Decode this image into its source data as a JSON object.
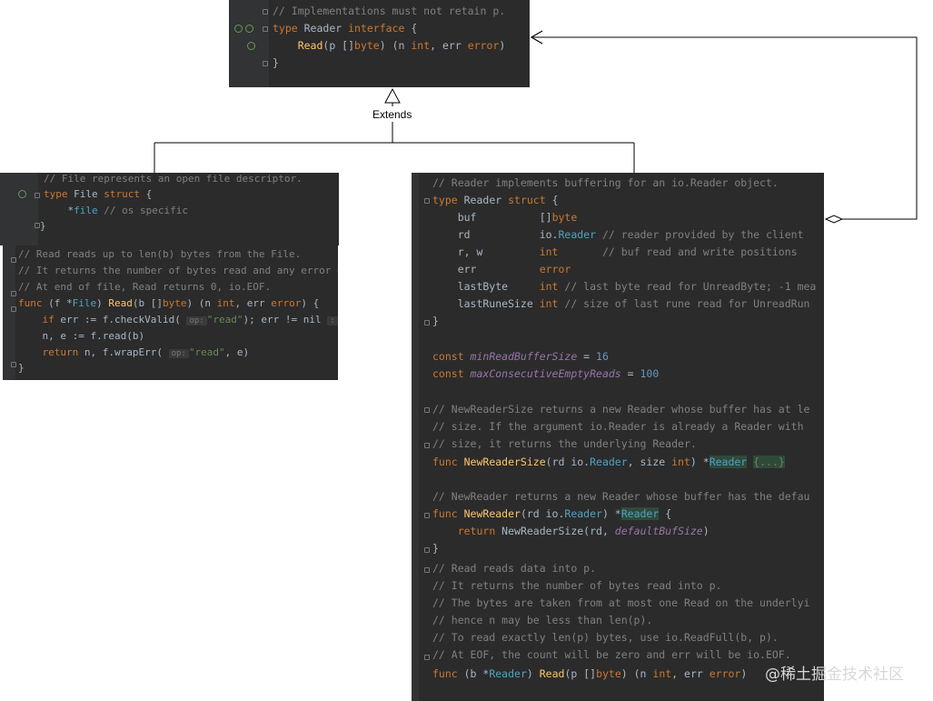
{
  "extends_label": "Extends",
  "watermark": "@稀土掘金技术社区",
  "reader_interface": [
    "// Implementations must not retain p.",
    "type Reader interface {",
    "    Read(p []byte) (n int, err error)",
    "}"
  ],
  "file_struct": [
    "// File represents an open file descriptor.",
    "type File struct {",
    "    *file // os specific",
    "}"
  ],
  "file_read": {
    "comments": [
      "// Read reads up to len(b) bytes from the File.",
      "// It returns the number of bytes read and any error e",
      "// At end of file, Read returns 0, io.EOF."
    ],
    "sig": "func (f *File) Read(b []byte) (n int, err error) {",
    "l1": "if err := f.checkValid(",
    "l1_hint": "op:",
    "l1_str": "\"read\"",
    "l1_rest": "); err != nil",
    "l1_hint2": ": 0",
    "l2": "n, e := f.read(b)",
    "l3a": "return n, f.wrapErr(",
    "l3_hint": "op:",
    "l3_str": "\"read\"",
    "l3_rest": ", e)",
    "close": "}"
  },
  "bufio_reader": {
    "comment": "// Reader implements buffering for an io.Reader object.",
    "decl": "type Reader struct {",
    "fields": [
      {
        "name": "buf",
        "type": "[]byte",
        "comment": ""
      },
      {
        "name": "rd",
        "type": "io.Reader",
        "comment": "// reader provided by the client"
      },
      {
        "name": "r, w",
        "type": "int",
        "comment": "// buf read and write positions"
      },
      {
        "name": "err",
        "type": "error",
        "comment": ""
      },
      {
        "name": "lastByte",
        "type": "int",
        "comment": "// last byte read for UnreadByte; -1 mea"
      },
      {
        "name": "lastRuneSize",
        "type": "int",
        "comment": "// size of last rune read for UnreadRun"
      }
    ],
    "close": "}",
    "const1_name": "minReadBufferSize",
    "const1_val": "16",
    "const2_name": "maxConsecutiveEmptyReads",
    "const2_val": "100",
    "nrs_comments": [
      "// NewReaderSize returns a new Reader whose buffer has at le",
      "// size. If the argument io.Reader is already a Reader with",
      "// size, it returns the underlying Reader."
    ],
    "nrs_sig": "func NewReaderSize(rd io.Reader, size int) *Reader {...}",
    "nr_comment": "// NewReader returns a new Reader whose buffer has the defau",
    "nr_sig": "func NewReader(rd io.Reader) *Reader {",
    "nr_body": "return NewReaderSize(rd, defaultBufSize)",
    "nr_close": "}",
    "read_comments": [
      "// Read reads data into p.",
      "// It returns the number of bytes read into p.",
      "// The bytes are taken from at most one Read on the underlyi",
      "// hence n may be less than len(p).",
      "// To read exactly len(p) bytes, use io.ReadFull(b, p).",
      "// At EOF, the count will be zero and err will be io.EOF."
    ],
    "read_sig": "func (b *Reader) Read(p []byte) (n int, err error)"
  }
}
